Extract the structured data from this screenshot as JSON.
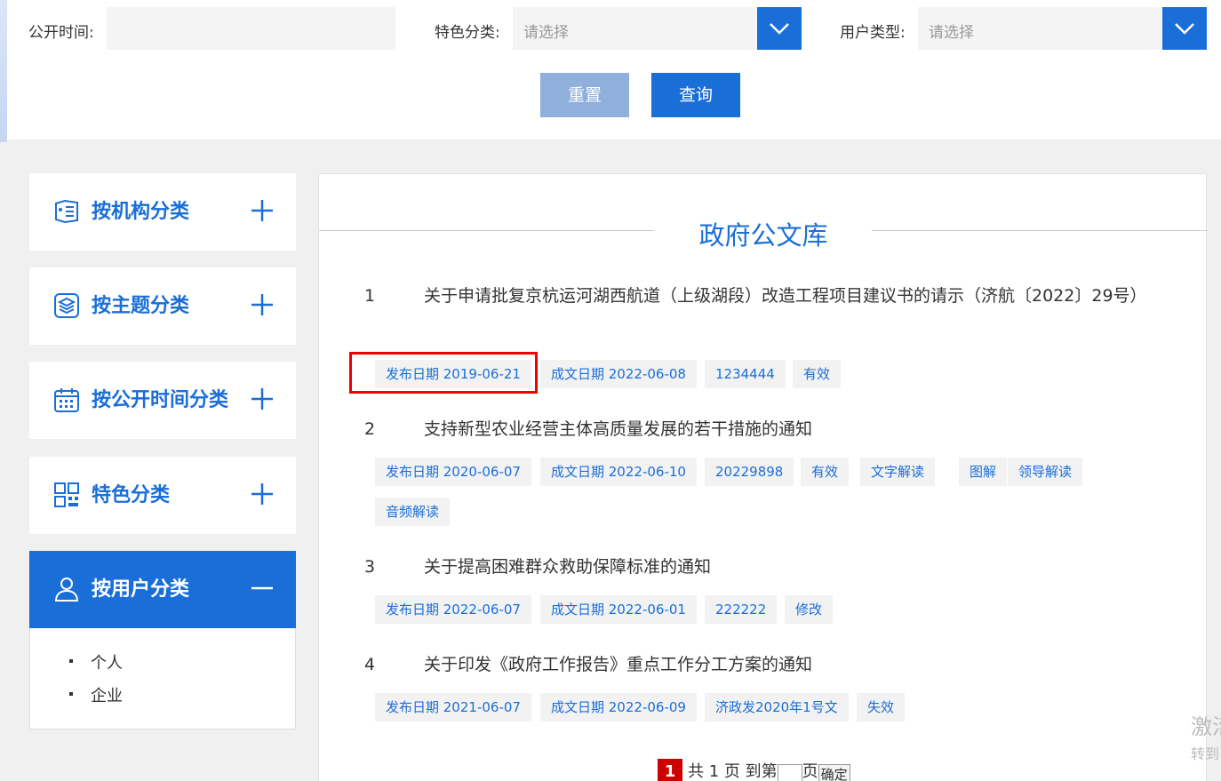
{
  "filter": {
    "date_label": "公开时间:",
    "feature_label": "特色分类:",
    "feature_placeholder": "请选择",
    "user_label": "用户类型:",
    "user_placeholder": "请选择",
    "reset_label": "重置",
    "query_label": "查询"
  },
  "sidebar": {
    "items": [
      {
        "label": "按机构分类",
        "icon": "org-list-icon",
        "toggle": "+"
      },
      {
        "label": "按主题分类",
        "icon": "layers-icon",
        "toggle": "+"
      },
      {
        "label": "按公开时间分类",
        "icon": "calendar-icon",
        "toggle": "+"
      },
      {
        "label": "特色分类",
        "icon": "grid-icon",
        "toggle": "+"
      },
      {
        "label": "按用户分类",
        "icon": "user-icon",
        "toggle": "-"
      }
    ],
    "sub_items": [
      "个人",
      "企业"
    ]
  },
  "main": {
    "title": "政府公文库",
    "docs": [
      {
        "num": "1",
        "title": "关于申请批复京杭运河湖西航道（上级湖段）改造工程项目建议书的请示（济航〔2022〕29号）",
        "tags": [
          "发布日期 2019-06-21",
          "成文日期 2022-06-08",
          "1234444",
          "有效"
        ]
      },
      {
        "num": "2",
        "title": "支持新型农业经营主体高质量发展的若干措施的通知",
        "tags": [
          "发布日期 2020-06-07",
          "成文日期 2022-06-10",
          "20229898",
          "有效",
          "文字解读",
          "图解",
          "领导解读",
          "音频解读"
        ]
      },
      {
        "num": "3",
        "title": "关于提高困难群众救助保障标准的通知",
        "tags": [
          "发布日期 2022-06-07",
          "成文日期 2022-06-01",
          "222222",
          "修改"
        ]
      },
      {
        "num": "4",
        "title": "关于印发《政府工作报告》重点工作分工方案的通知",
        "tags": [
          "发布日期 2021-06-07",
          "成文日期 2022-06-09",
          "济政发2020年1号文",
          "失效"
        ]
      }
    ]
  },
  "pager": {
    "current": "1",
    "text": "共 1 页 到第",
    "page_suffix": "页",
    "confirm": "确定"
  },
  "watermark": {
    "line1": "激活",
    "line2": "转到"
  },
  "colors": {
    "accent": "#1a6ed8",
    "reset": "#8fb0da",
    "highlight": "#e00000"
  }
}
